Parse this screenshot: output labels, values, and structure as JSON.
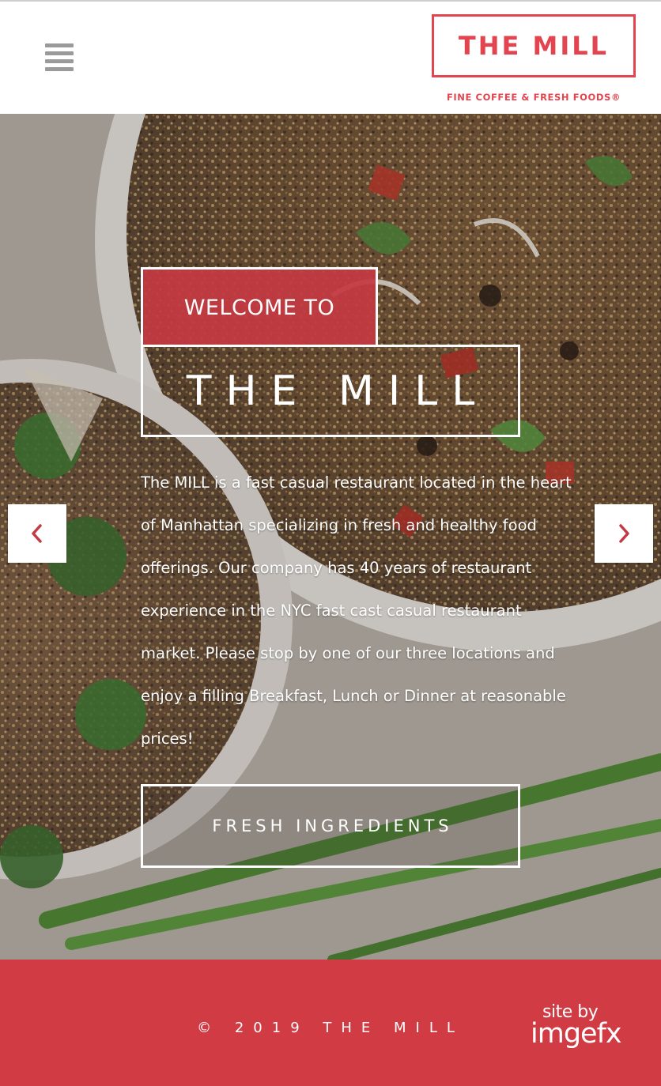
{
  "header": {
    "menu_icon": "hamburger-menu-icon",
    "logo": {
      "title": "THE MILL",
      "tagline": "FINE COFFEE & FRESH FOODS®",
      "color": "#e2454f"
    }
  },
  "hero": {
    "welcome": "WELCOME TO",
    "title": "THE MILL",
    "description": "The MILL is a fast casual restaurant located in the heart of Manhattan specializing in fresh and healthy food offerings. Our company has 40 years of restaurant experience in the NYC fast cast casual restaurant market. Please stop by one of our three locations and enjoy a filling Breakfast, Lunch or Dinner at reasonable prices!",
    "cta_label": "FRESH INGREDIENTS",
    "prev_icon": "chevron-left-icon",
    "next_icon": "chevron-right-icon",
    "accent": "#c43a42"
  },
  "footer": {
    "copyright": "© 2019 THE MILL",
    "credit_line1": "site by",
    "credit_line2": "imgefx",
    "background": "#d03b44"
  }
}
